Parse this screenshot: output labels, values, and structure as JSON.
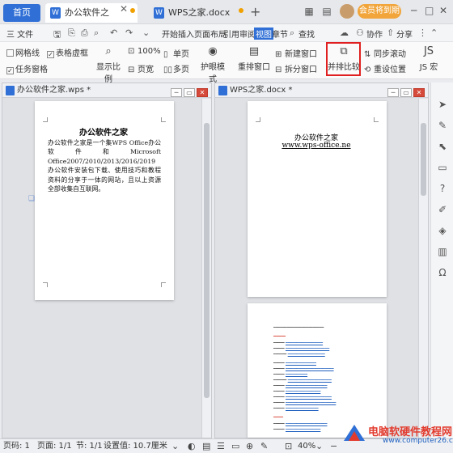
{
  "tabs": {
    "home": "首页",
    "doc1": "办公软件之家.wps",
    "doc2": "WPS之家.docx"
  },
  "titlebar": {
    "member_label": "会员将到期"
  },
  "menu": {
    "file": "三 文件",
    "items": [
      "开始",
      "插入",
      "页面布局",
      "引用",
      "审阅",
      "视图",
      "章节"
    ],
    "search": "查找",
    "collab": "协作",
    "share": "分享"
  },
  "ribbon": {
    "grid": "网格线",
    "table_dashed": "表格虚框",
    "task_pane": "任务窗格",
    "display_ratio": "显示比例",
    "zoom_100": "100%",
    "page_width": "页宽",
    "single_page": "单页",
    "multi_page": "多页",
    "eye_mode": "护眼模式",
    "rearrange": "重排窗口",
    "new_window": "新建窗口",
    "split_window": "拆分窗口",
    "side_by_side": "并排比较",
    "sync_scroll": "同步滚动",
    "reset_position": "重设位置",
    "js_macro": "JS 宏"
  },
  "left_pane": {
    "title": "办公软件之家.wps *",
    "doc_title": "办公软件之家",
    "body": "办公软件之家是一个集WPS Office办公软件和Microsoft Office2007/2010/2013/2016/2019办公软件安装包下载、使用技巧和教程资料的分享于一体的网站，且以上资源全部收集自互联网。"
  },
  "right_pane": {
    "title": "WPS之家.docx *",
    "doc_title": "办公软件之家",
    "doc_url": "www.wps-office.ne"
  },
  "statusbar": {
    "page_code": "页码: 1",
    "page": "页面: 1/1",
    "section": "节: 1/1",
    "setting": "设置值: 10.7厘米",
    "zoom": "40%"
  },
  "watermark": {
    "text": "电脑软硬件教程网",
    "url": "www.computer26.com"
  },
  "colors": {
    "accent": "#2f6fd6",
    "highlight": "#e02020",
    "member": "#f1a53b"
  }
}
